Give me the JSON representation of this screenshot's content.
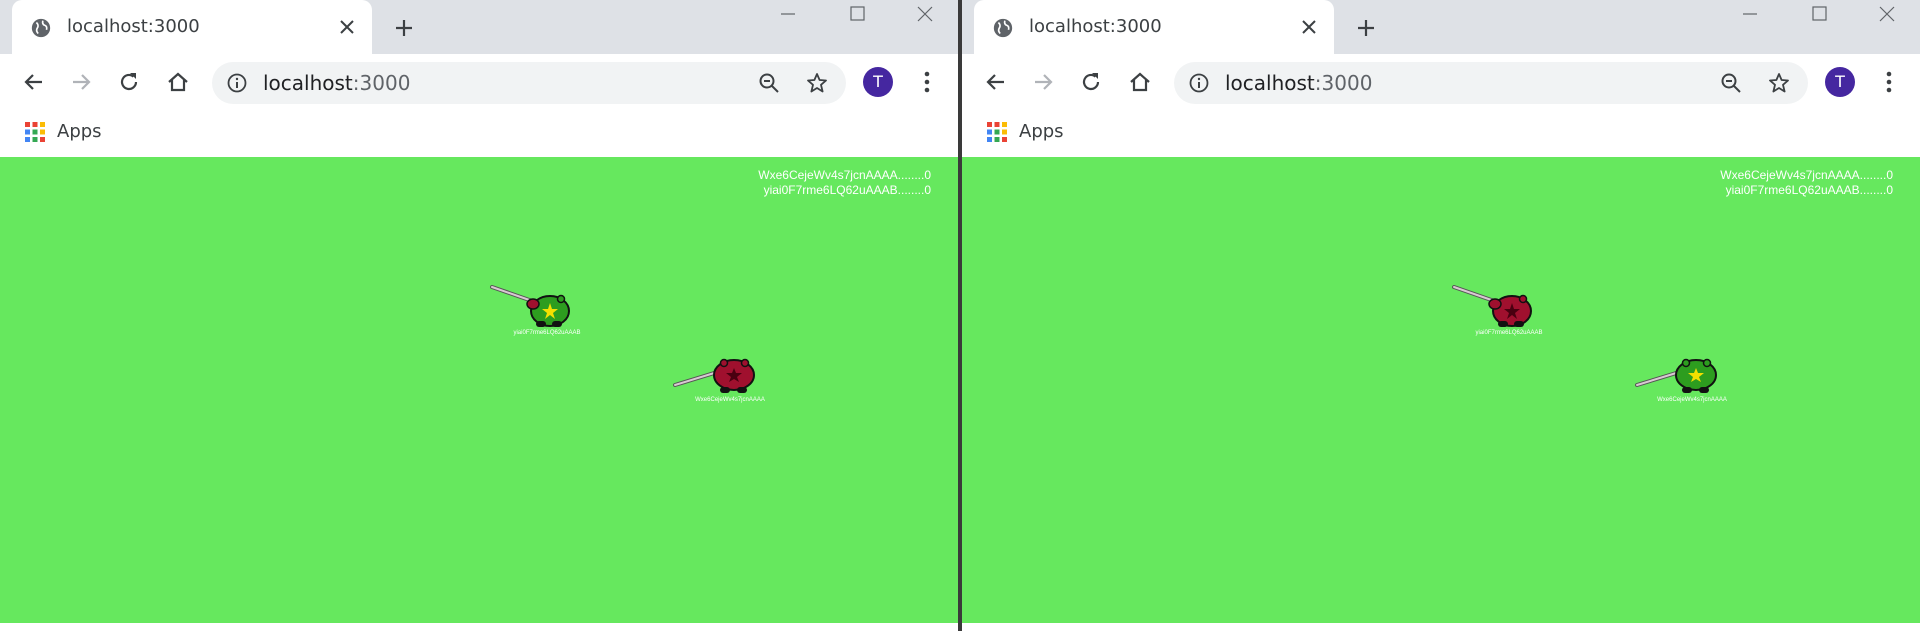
{
  "windows": [
    {
      "tab": {
        "title": "localhost:3000"
      },
      "omnibox": {
        "host": "localhost",
        "port": ":3000"
      },
      "profile": {
        "initial": "T"
      },
      "bookmarks": {
        "apps_label": "Apps"
      },
      "game": {
        "background": "#66e85e",
        "scoreboard": [
          {
            "text": "Wxe6CejeWv4s7jcnAAAA........0"
          },
          {
            "text": "yiai0F7rme6LQ62uAAAB........0"
          }
        ],
        "players": [
          {
            "label": "yiai0F7rme6LQ62uAAAB",
            "color": "green"
          },
          {
            "label": "Wxe6CejeWv4s7jcnAAAA",
            "color": "crimson"
          }
        ]
      }
    },
    {
      "tab": {
        "title": "localhost:3000"
      },
      "omnibox": {
        "host": "localhost",
        "port": ":3000"
      },
      "profile": {
        "initial": "T"
      },
      "bookmarks": {
        "apps_label": "Apps"
      },
      "game": {
        "background": "#66e85e",
        "scoreboard": [
          {
            "text": "Wxe6CejeWv4s7jcnAAAA........0"
          },
          {
            "text": "yiai0F7rme6LQ62uAAAB........0"
          }
        ],
        "players": [
          {
            "label": "yiai0F7rme6LQ62uAAAB",
            "color": "crimson"
          },
          {
            "label": "Wxe6CejeWv4s7jcnAAAA",
            "color": "green"
          }
        ]
      }
    }
  ],
  "colors": {
    "tabstrip": "#dee1e6",
    "avatar": "#4527a0",
    "tank_green": "#2d9d1f",
    "tank_crimson": "#a0102e"
  }
}
